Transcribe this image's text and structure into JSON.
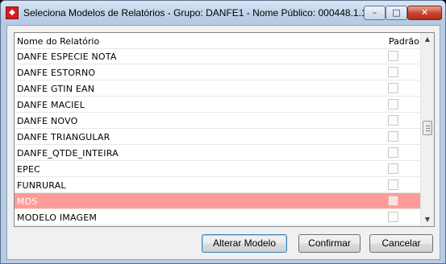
{
  "window": {
    "title": "Seleciona Modelos de Relatórios - Grupo: DANFE1 - Nome Público: 000448.1.1",
    "controls": {
      "minimize": "–",
      "maximize": "□",
      "close": "✕"
    }
  },
  "grid": {
    "columns": {
      "name": "Nome do Relatório",
      "default": "Padrão"
    },
    "rows": [
      {
        "name": "DANFE ESPECIE NOTA",
        "default": false,
        "selected": false
      },
      {
        "name": "DANFE ESTORNO",
        "default": false,
        "selected": false
      },
      {
        "name": "DANFE GTIN EAN",
        "default": false,
        "selected": false
      },
      {
        "name": "DANFE MACIEL",
        "default": false,
        "selected": false
      },
      {
        "name": "DANFE NOVO",
        "default": false,
        "selected": false
      },
      {
        "name": "DANFE TRIANGULAR",
        "default": false,
        "selected": false
      },
      {
        "name": "DANFE_QTDE_INTEIRA",
        "default": false,
        "selected": false
      },
      {
        "name": "EPEC",
        "default": false,
        "selected": false
      },
      {
        "name": "FUNRURAL",
        "default": false,
        "selected": false
      },
      {
        "name": "MDS",
        "default": false,
        "selected": true
      },
      {
        "name": "MODELO IMAGEM",
        "default": false,
        "selected": false
      }
    ],
    "selected_row_color": "#ff9c98"
  },
  "buttons": {
    "alterar": "Alterar Modelo",
    "confirmar": "Confirmar",
    "cancelar": "Cancelar"
  }
}
